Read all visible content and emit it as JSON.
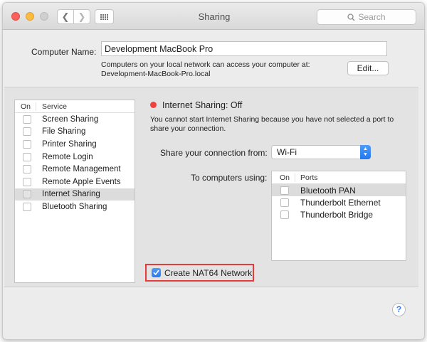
{
  "window": {
    "title": "Sharing",
    "search_placeholder": "Search"
  },
  "computer_name": {
    "label": "Computer Name:",
    "value": "Development MacBook Pro",
    "info_line1": "Computers on your local network can access your computer at:",
    "info_line2": "Development-MacBook-Pro.local",
    "edit_label": "Edit..."
  },
  "services": {
    "header_on": "On",
    "header_service": "Service",
    "items": [
      {
        "label": "Screen Sharing",
        "checked": false
      },
      {
        "label": "File Sharing",
        "checked": false
      },
      {
        "label": "Printer Sharing",
        "checked": false
      },
      {
        "label": "Remote Login",
        "checked": false
      },
      {
        "label": "Remote Management",
        "checked": false
      },
      {
        "label": "Remote Apple Events",
        "checked": false
      },
      {
        "label": "Internet Sharing",
        "checked": false,
        "selected": true
      },
      {
        "label": "Bluetooth Sharing",
        "checked": false
      }
    ]
  },
  "internet_sharing": {
    "status": "Internet Sharing: Off",
    "status_color": "#f0423c",
    "description_line1": "You cannot start Internet Sharing because you have not selected a port to",
    "description_line2": "share your connection.",
    "share_from_label": "Share your connection from:",
    "share_from_value": "Wi-Fi",
    "to_computers_label": "To computers using:",
    "ports_header_on": "On",
    "ports_header_ports": "Ports",
    "ports": [
      {
        "label": "Bluetooth PAN",
        "checked": false,
        "selected": true
      },
      {
        "label": "Thunderbolt Ethernet",
        "checked": false
      },
      {
        "label": "Thunderbolt Bridge",
        "checked": false
      }
    ],
    "nat64_label": "Create NAT64 Network",
    "nat64_checked": true,
    "highlight_color": "#e53b3b"
  },
  "help": {
    "label": "?"
  },
  "colors": {
    "accent": "#2a7bef",
    "window_bg": "#ececec"
  }
}
